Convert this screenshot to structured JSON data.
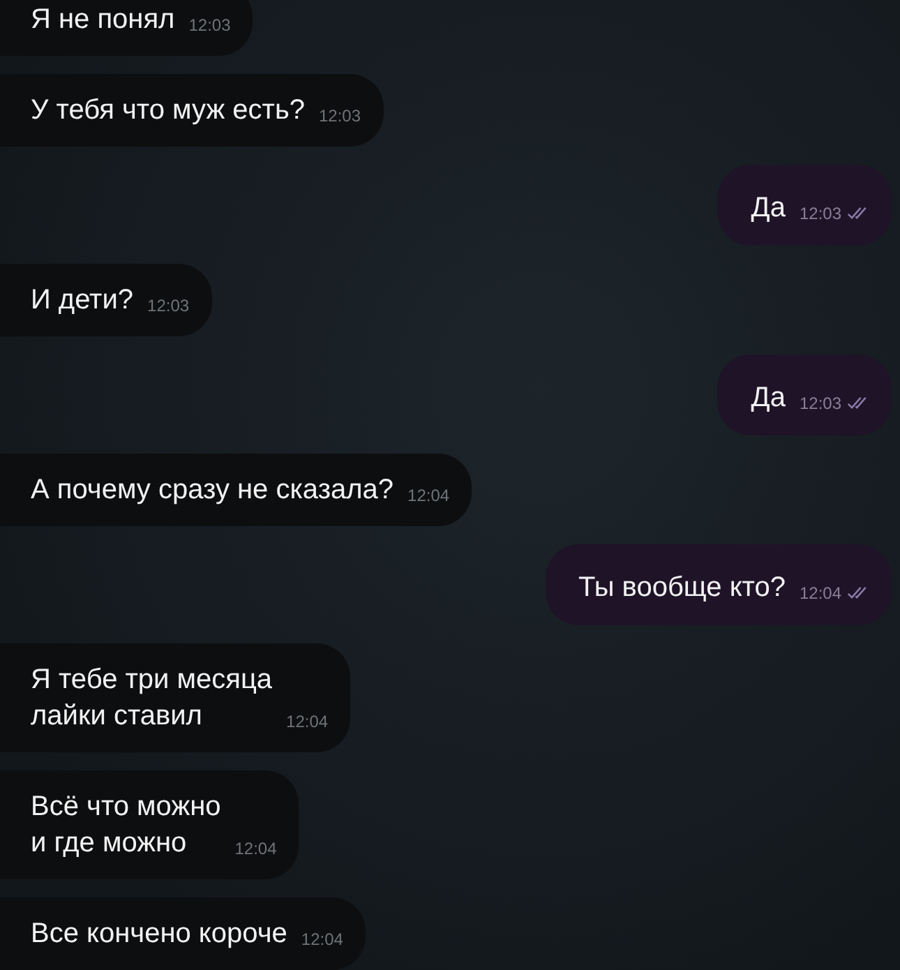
{
  "messages": [
    {
      "kind": "incoming",
      "text": "Я не понял",
      "time": "12:03"
    },
    {
      "kind": "incoming",
      "text": "У тебя что муж есть?",
      "time": "12:03"
    },
    {
      "kind": "outgoing",
      "text": "Да",
      "time": "12:03",
      "read": true
    },
    {
      "kind": "incoming",
      "text": "И дети?",
      "time": "12:03"
    },
    {
      "kind": "outgoing",
      "text": "Да",
      "time": "12:03",
      "read": true
    },
    {
      "kind": "incoming",
      "text": "А почему сразу не сказала?",
      "time": "12:04"
    },
    {
      "kind": "outgoing",
      "text": "Ты вообще кто?",
      "time": "12:04",
      "read": true
    },
    {
      "kind": "incoming",
      "text": "Я тебе три месяца\nлайки ставил",
      "time": "12:04"
    },
    {
      "kind": "incoming",
      "text": "Всё что можно\nи где можно",
      "time": "12:04"
    },
    {
      "kind": "incoming",
      "text": "Все кончено короче",
      "time": "12:04"
    }
  ]
}
